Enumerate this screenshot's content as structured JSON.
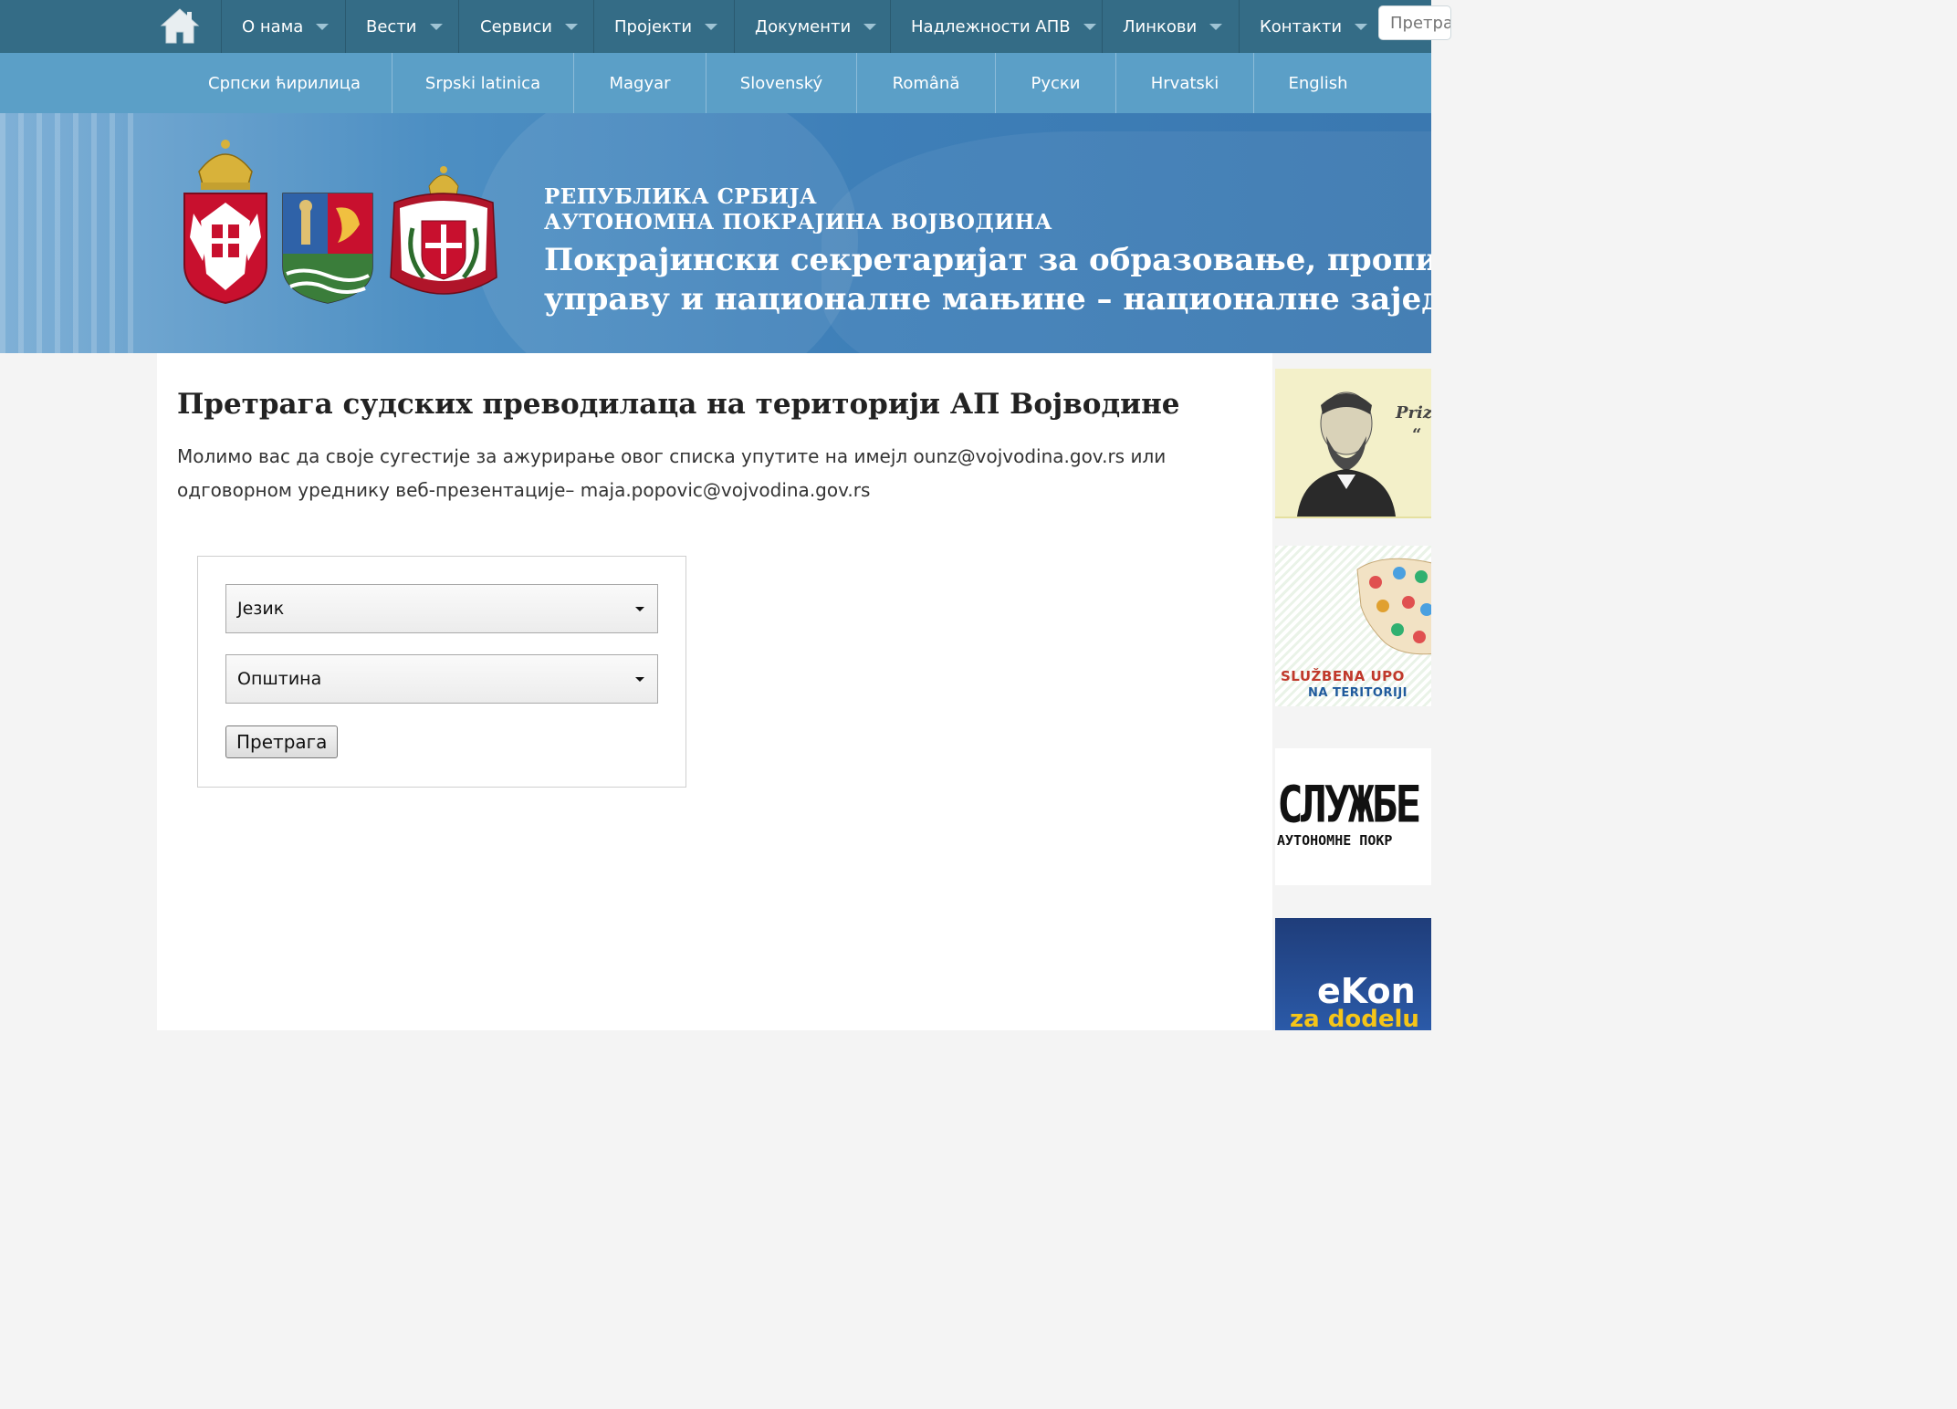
{
  "topnav": {
    "home_icon": "home-icon",
    "items": [
      {
        "label": "О нама",
        "has_dropdown": true
      },
      {
        "label": "Вести",
        "has_dropdown": true
      },
      {
        "label": "Сервиси",
        "has_dropdown": true
      },
      {
        "label": "Пројекти",
        "has_dropdown": true
      },
      {
        "label": "Документи",
        "has_dropdown": true
      },
      {
        "label": "Надлежности АПВ",
        "has_dropdown": true
      },
      {
        "label": "Линкови",
        "has_dropdown": true
      },
      {
        "label": "Контакти",
        "has_dropdown": true
      }
    ],
    "search_placeholder": "Претрага"
  },
  "languages": [
    "Српски ћирилица",
    "Srpski latinica",
    "Magyar",
    "Slovenský",
    "Română",
    "Руски",
    "Hrvatski",
    "English"
  ],
  "banner": {
    "line1": "РЕПУБЛИКА СРБИЈА",
    "line2": "АУТОНОМНА ПОКРАЈИНА ВОЈВОДИНА",
    "line3": "Покрајински секретаријат за образовање, прописе,",
    "line4": "управу и националне мањине – националне заједнице"
  },
  "main": {
    "title": "Претрага судских преводилаца на територији АП Војводине",
    "intro": "Молимо вас да своје сугестије за ажурирање овог списка упутите на имејл ounz@vojvodina.gov.rs или одговорном уреднику веб-презентације– maja.popovic@vojvodina.gov.rs",
    "form": {
      "language_select": "Језик",
      "municipality_select": "Општина",
      "search_button": "Претрага"
    }
  },
  "sidebar": {
    "ad1_text1": "Priz",
    "ad1_text2": "“",
    "ad2_text1": "SLUŽBENA UPO",
    "ad2_text2": "NA TERITORIJI",
    "ad3_text1": "СЛУЖБЕ",
    "ad3_text2": "АУТОНОМНЕ ПОКР",
    "ad4_text1": "eKon",
    "ad4_text2": "za dodelu"
  },
  "colors": {
    "topnav_bg": "#346c86",
    "langbar_bg": "#5b9fc7",
    "banner_bg": "#3e7fb8"
  }
}
